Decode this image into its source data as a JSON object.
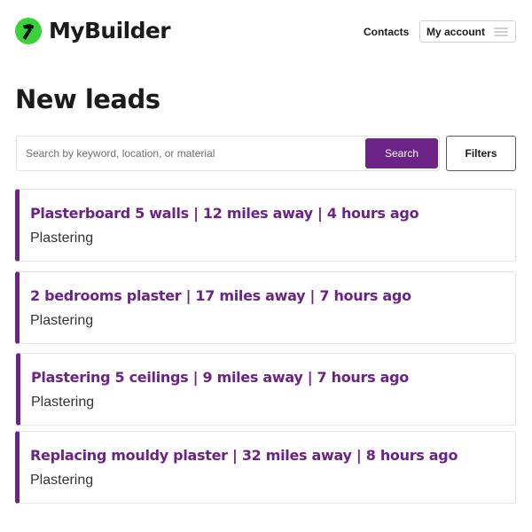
{
  "header": {
    "brand": "MyBuilder",
    "nav": {
      "contacts_label": "Contacts",
      "account_label": "My account"
    }
  },
  "page": {
    "title": "New leads"
  },
  "search": {
    "placeholder": "Search by keyword, location, or material",
    "value": "",
    "button_label": "Search",
    "filters_label": "Filters"
  },
  "leads": [
    {
      "title": "Plasterboard 5 walls | 12 miles away | 4 hours ago",
      "category": "Plastering"
    },
    {
      "title": "2 bedrooms plaster | 17 miles away | 7 hours ago",
      "category": "Plastering"
    },
    {
      "title": "Plastering 5 ceilings | 9 miles away | 7 hours ago",
      "category": "Plastering"
    },
    {
      "title": "Replacing mouldy plaster | 32 miles away | 8 hours ago",
      "category": "Plastering"
    }
  ],
  "colors": {
    "brand_green": "#3ad23a",
    "accent_purple": "#6b2385"
  },
  "icons": {
    "logo": "hammer-icon",
    "menu": "hamburger-menu-icon"
  }
}
